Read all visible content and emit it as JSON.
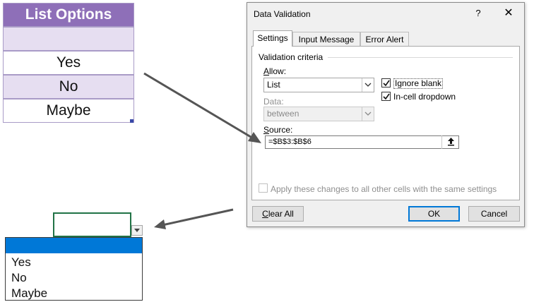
{
  "table": {
    "header": "List Options",
    "rows": [
      "",
      "Yes",
      "No",
      "Maybe"
    ]
  },
  "dialog": {
    "title": "Data Validation",
    "help_icon": "?",
    "close_icon": "✕",
    "tabs": [
      "Settings",
      "Input Message",
      "Error Alert"
    ],
    "active_tab": "Settings",
    "section_title": "Validation criteria",
    "allow_label": "Allow:",
    "allow_value": "List",
    "data_label": "Data:",
    "data_value": "between",
    "ignore_blank_label": "Ignore blank",
    "ignore_blank_checked": true,
    "incell_dropdown_label": "In-cell dropdown",
    "incell_dropdown_checked": true,
    "source_label": "Source:",
    "source_value": "=$B$3:$B$6",
    "apply_all_label": "Apply these changes to all other cells with the same settings",
    "apply_all_checked": false,
    "clear_all_label": "Clear All",
    "ok_label": "OK",
    "cancel_label": "Cancel"
  },
  "cell_dropdown": {
    "items": [
      "",
      "Yes",
      "No",
      "Maybe"
    ],
    "highlighted_index": 0
  },
  "colors": {
    "header_purple": "#8e6fb8",
    "band_lavender": "#e6def1",
    "selection_blue": "#0078d7",
    "excel_green": "#217346",
    "arrow_gray": "#555555"
  },
  "icons": {
    "help": "help-icon",
    "close": "close-icon",
    "dropdown": "chevron-down-icon",
    "checkmark": "checkmark-icon",
    "collapse": "collapse-dialog-icon"
  }
}
